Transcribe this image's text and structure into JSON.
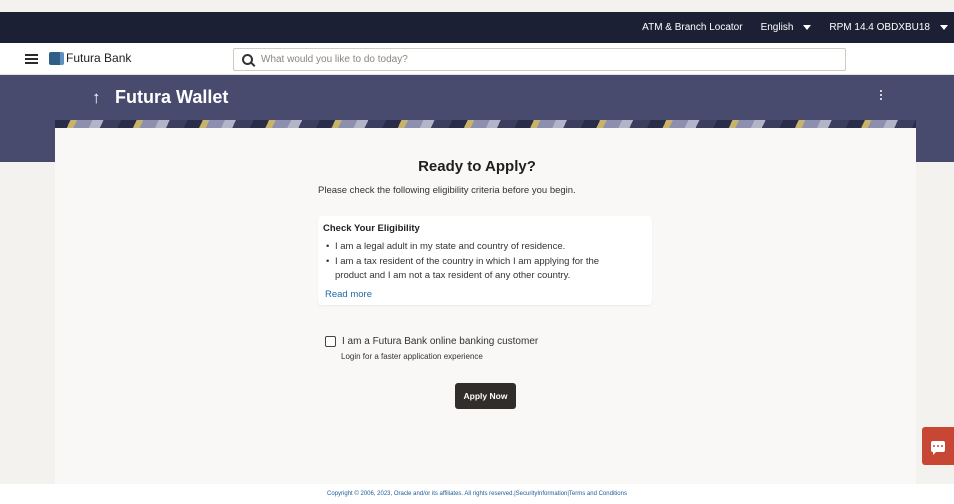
{
  "top_bar": {
    "atm_locator": "ATM & Branch Locator",
    "language": "English",
    "user": "RPM 14.4 OBDXBU18"
  },
  "header": {
    "bank_name": "Futura Bank",
    "search_placeholder": "What would you like to do today?"
  },
  "banner": {
    "back_arrow": "↑",
    "title": "Futura Wallet"
  },
  "main": {
    "heading": "Ready to Apply?",
    "subtext": "Please check the following eligibility criteria before you begin.",
    "eligibility": {
      "title": "Check Your Eligibility",
      "bullet_1": "I am a legal adult in my state and country of residence.",
      "bullet_2_line_1": "I am a tax resident of the country in which I am applying for the",
      "bullet_2_line_2": "product and I am not a tax resident of any other country.",
      "read_more": "Read more"
    },
    "checkbox_label": "I am a Futura Bank online banking customer",
    "checkbox_helper": "Login for a faster application experience",
    "apply_button": "Apply Now"
  },
  "footer": {
    "copyright": "Copyright © 2006, 2023, Oracle and/or its affiliates. All rights reserved.|SecurityInformation|Terms and Conditions"
  },
  "colors": {
    "top_bar": "#1c2034",
    "banner": "#484b6e",
    "apply_button": "#312d2a",
    "chat_button": "#c74634",
    "link": "#1d6aa8"
  }
}
